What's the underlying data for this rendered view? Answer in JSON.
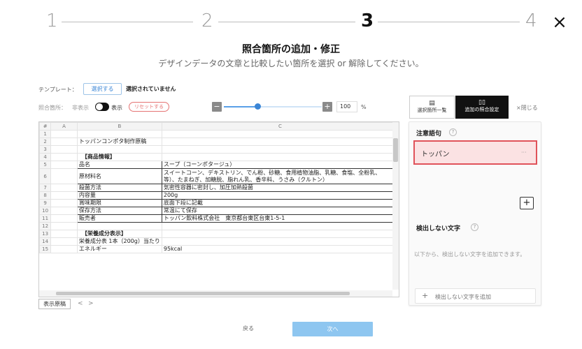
{
  "steps": [
    "1",
    "2",
    "3",
    "4"
  ],
  "active_step": "3",
  "close_icon": "×",
  "title": "照合箇所の追加・修正",
  "subtitle": "デザインデータの文章と比較したい箇所を選択 or 解除してください。",
  "template": {
    "label": "テンプレート：",
    "select_button": "選択する",
    "status": "選択されていません"
  },
  "match_area": {
    "label": "照合箇所：",
    "hidden_label": "非表示",
    "shown_label": "表示",
    "toggle_on": true,
    "reset_button": "リセットする"
  },
  "zoom": {
    "minus": "−",
    "plus": "+",
    "value": "100",
    "unit": "%",
    "level_percent": 100
  },
  "sheet": {
    "corner": "#",
    "columns": [
      "A",
      "B",
      "C"
    ],
    "rows": [
      {
        "n": "1",
        "b": "",
        "c": ""
      },
      {
        "n": "2",
        "b": "トッパンコンポタ制作原稿",
        "c": ""
      },
      {
        "n": "3",
        "b": "",
        "c": ""
      },
      {
        "n": "4",
        "b": "【商品情報】",
        "c": ""
      },
      {
        "n": "5",
        "b": "品名",
        "c": "スープ（コーンポタージュ）"
      },
      {
        "n": "6",
        "b": "原材料名",
        "c": "スイートコーン、デキストリン、でん粉、砂糖、食用植物油脂、乳糖、食塩、全粉乳、",
        "c2": "等）、たまねぎ、加糖脱、脂れん乳、香辛料、うさみ（クルトン）"
      },
      {
        "n": "7",
        "b": "殺菌方法",
        "c": "気密性容器に密封し、加圧加熱殺菌"
      },
      {
        "n": "8",
        "b": "内容量",
        "c": "200g"
      },
      {
        "n": "9",
        "b": "賞味期限",
        "c": "底面下段に記載"
      },
      {
        "n": "10",
        "b": "保存方法",
        "c": "常温にて保存"
      },
      {
        "n": "11",
        "b": "販売者",
        "c": "トッパン飲料株式会社　東京都台東区台東1-5-1"
      },
      {
        "n": "12",
        "b": "",
        "c": ""
      },
      {
        "n": "13",
        "b": "【栄養成分表示】",
        "c": ""
      },
      {
        "n": "14",
        "b": "栄養成分表 1本（200g）当たり",
        "c": ""
      },
      {
        "n": "15",
        "b": "エネルギー",
        "c": "95kcal"
      }
    ],
    "sheet_tab": "表示原稿",
    "prev_icon": "<",
    "next_icon": ">"
  },
  "panel": {
    "tab_list": "選択箇所一覧",
    "tab_settings": "追加の照合設定",
    "close": "×閉じる",
    "caution_title": "注意語句",
    "caution_words": [
      "トッパン"
    ],
    "more_icon": "···",
    "add_icon": "+",
    "exclude_title": "検出しない文字",
    "exclude_hint": "以下から、検出しない文字を追加できます。",
    "exclude_add": "検出しない文字を追加",
    "help_icon": "?"
  },
  "footer": {
    "back": "戻る",
    "next": "次へ"
  },
  "colors": {
    "accent": "#3b86d6",
    "next_button": "#8ec6f0",
    "highlight_border": "#e0525a",
    "highlight_bg": "#fbe2e3",
    "reset": "#e57373"
  }
}
